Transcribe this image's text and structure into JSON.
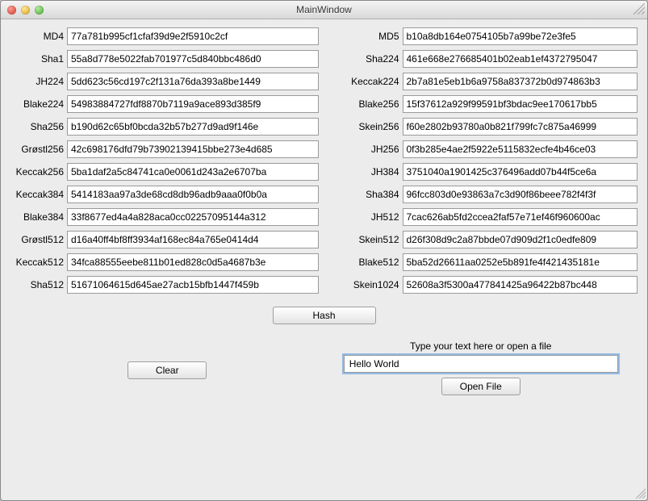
{
  "window": {
    "title": "MainWindow"
  },
  "hashes": {
    "left": [
      {
        "label": "MD4",
        "value": "77a781b995cf1cfaf39d9e2f5910c2cf"
      },
      {
        "label": "Sha1",
        "value": "55a8d778e5022fab701977c5d840bbc486d0"
      },
      {
        "label": "JH224",
        "value": "5dd623c56cd197c2f131a76da393a8be1449"
      },
      {
        "label": "Blake224",
        "value": "54983884727fdf8870b7119a9ace893d385f9"
      },
      {
        "label": "Sha256",
        "value": "b190d62c65bf0bcda32b57b277d9ad9f146e"
      },
      {
        "label": "Grøstl256",
        "value": "42c698176dfd79b73902139415bbe273e4d685"
      },
      {
        "label": "Keccak256",
        "value": "5ba1daf2a5c84741ca0e0061d243a2e6707ba"
      },
      {
        "label": "Keccak384",
        "value": "5414183aa97a3de68cd8db96adb9aaa0f0b0a"
      },
      {
        "label": "Blake384",
        "value": "33f8677ed4a4a828aca0cc02257095144a312"
      },
      {
        "label": "Grøstl512",
        "value": "d16a40ff4bf8ff3934af168ec84a765e0414d4"
      },
      {
        "label": "Keccak512",
        "value": "34fca88555eebe811b01ed828c0d5a4687b3e"
      },
      {
        "label": "Sha512",
        "value": "51671064615d645ae27acb15bfb1447f459b"
      }
    ],
    "right": [
      {
        "label": "MD5",
        "value": "b10a8db164e0754105b7a99be72e3fe5"
      },
      {
        "label": "Sha224",
        "value": "461e668e276685401b02eab1ef4372795047"
      },
      {
        "label": "Keccak224",
        "value": "2b7a81e5eb1b6a9758a837372b0d974863b3"
      },
      {
        "label": "Blake256",
        "value": "15f37612a929f99591bf3bdac9ee170617bb5"
      },
      {
        "label": "Skein256",
        "value": "f60e2802b93780a0b821f799fc7c875a46999"
      },
      {
        "label": "JH256",
        "value": "0f3b285e4ae2f5922e5115832ecfe4b46ce03"
      },
      {
        "label": "JH384",
        "value": "3751040a1901425c376496add07b44f5ce6a"
      },
      {
        "label": "Sha384",
        "value": "96fcc803d0e93863a7c3d90f86beee782f4f3f"
      },
      {
        "label": "JH512",
        "value": "7cac626ab5fd2ccea2faf57e71ef46f960600ac"
      },
      {
        "label": "Skein512",
        "value": "d26f308d9c2a87bbde07d909d2f1c0edfe809"
      },
      {
        "label": "Blake512",
        "value": "5ba52d26611aa0252e5b891fe4f421435181e"
      },
      {
        "label": "Skein1024",
        "value": "52608a3f5300a477841425a96422b87bc448"
      }
    ]
  },
  "buttons": {
    "hash": "Hash",
    "clear": "Clear",
    "open_file": "Open File"
  },
  "input": {
    "hint": "Type your text here or open a file",
    "value": "Hello World"
  }
}
